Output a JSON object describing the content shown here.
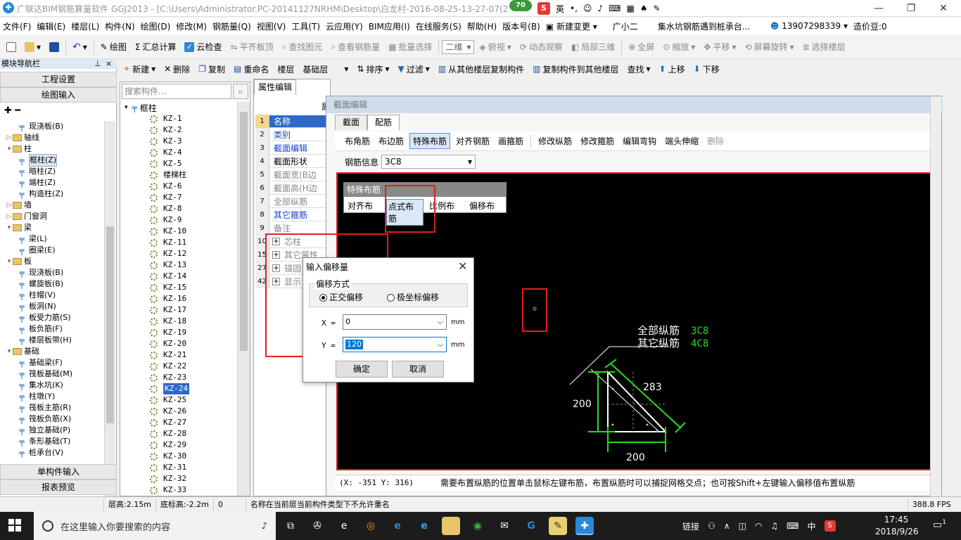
{
  "title": {
    "text": "广联达BIM钢筋算量软件 GGJ2013 - [C:\\Users\\Administrator.PC-20141127NRHM\\Desktop\\白龙村-2016-08-25-13-27-07(21",
    "badge": "70",
    "ime": [
      "英",
      "•,"
    ]
  },
  "menu": [
    "文件(F)",
    "编辑(E)",
    "楼层(L)",
    "构件(N)",
    "绘图(D)",
    "修改(M)",
    "钢筋量(Q)",
    "视图(V)",
    "工具(T)",
    "云应用(Y)",
    "BIM应用(I)",
    "在线服务(S)",
    "帮助(H)",
    "版本号(B)",
    "新建变更",
    "广小二",
    "集水坑钢筋遇到桩承台...",
    "13907298339",
    "造价豆:0"
  ],
  "toolbar1": {
    "items": [
      "绘图",
      "汇总计算",
      "云检查",
      "平齐板顶",
      "查找图元",
      "查看钢筋量",
      "批量选择"
    ],
    "view_mode": "二维",
    "right": [
      "俯视",
      "动态观察",
      "局部三维",
      "全屏",
      "缩放",
      "平移",
      "屏幕旋转",
      "选择楼层"
    ]
  },
  "toolbar2": [
    "新建",
    "删除",
    "复制",
    "重命名",
    "楼层",
    "基础层",
    "排序",
    "过滤",
    "从其他楼层复制构件",
    "复制构件到其他楼层",
    "查找",
    "上移",
    "下移"
  ],
  "nav": {
    "header": "模块导航栏",
    "buttons_top": [
      "工程设置",
      "绘图输入"
    ],
    "tree": [
      {
        "label": "现浇板(B)",
        "indent": 3,
        "type": "item"
      },
      {
        "label": "轴线",
        "indent": 1,
        "type": "folder",
        "tw": "▷"
      },
      {
        "label": "柱",
        "indent": 1,
        "type": "folder",
        "tw": "▾"
      },
      {
        "label": "框柱(Z)",
        "indent": 3,
        "type": "item",
        "sel": true
      },
      {
        "label": "暗柱(Z)",
        "indent": 3,
        "type": "item"
      },
      {
        "label": "端柱(Z)",
        "indent": 3,
        "type": "item"
      },
      {
        "label": "构造柱(Z)",
        "indent": 3,
        "type": "item"
      },
      {
        "label": "墙",
        "indent": 1,
        "type": "folder",
        "tw": "▷"
      },
      {
        "label": "门窗洞",
        "indent": 1,
        "type": "folder",
        "tw": "▷"
      },
      {
        "label": "梁",
        "indent": 1,
        "type": "folder",
        "tw": "▾"
      },
      {
        "label": "梁(L)",
        "indent": 3,
        "type": "item"
      },
      {
        "label": "圈梁(E)",
        "indent": 3,
        "type": "item"
      },
      {
        "label": "板",
        "indent": 1,
        "type": "folder",
        "tw": "▾"
      },
      {
        "label": "现浇板(B)",
        "indent": 3,
        "type": "item"
      },
      {
        "label": "螺旋板(B)",
        "indent": 3,
        "type": "item"
      },
      {
        "label": "柱帽(V)",
        "indent": 3,
        "type": "item"
      },
      {
        "label": "板洞(N)",
        "indent": 3,
        "type": "item"
      },
      {
        "label": "板受力筋(S)",
        "indent": 3,
        "type": "item"
      },
      {
        "label": "板负筋(F)",
        "indent": 3,
        "type": "item"
      },
      {
        "label": "楼层板带(H)",
        "indent": 3,
        "type": "item"
      },
      {
        "label": "基础",
        "indent": 1,
        "type": "folder",
        "tw": "▾"
      },
      {
        "label": "基础梁(F)",
        "indent": 3,
        "type": "item"
      },
      {
        "label": "筏板基础(M)",
        "indent": 3,
        "type": "item"
      },
      {
        "label": "集水坑(K)",
        "indent": 3,
        "type": "item"
      },
      {
        "label": "柱墩(Y)",
        "indent": 3,
        "type": "item"
      },
      {
        "label": "筏板主筋(R)",
        "indent": 3,
        "type": "item"
      },
      {
        "label": "筏板负筋(X)",
        "indent": 3,
        "type": "item"
      },
      {
        "label": "独立基础(P)",
        "indent": 3,
        "type": "item"
      },
      {
        "label": "条形基础(T)",
        "indent": 3,
        "type": "item"
      },
      {
        "label": "桩承台(V)",
        "indent": 3,
        "type": "item"
      }
    ],
    "buttons_bottom": [
      "单构件输入",
      "报表预览"
    ]
  },
  "list": {
    "search_placeholder": "搜索构件...",
    "root": "框柱",
    "items": [
      "KZ-1",
      "KZ-2",
      "KZ-3",
      "KZ-4",
      "KZ-5",
      "楼梯柱",
      "KZ-6",
      "KZ-7",
      "KZ-8",
      "KZ-9",
      "KZ-10",
      "KZ-11",
      "KZ-12",
      "KZ-13",
      "KZ-14",
      "KZ-15",
      "KZ-16",
      "KZ-17",
      "KZ-18",
      "KZ-19",
      "KZ-20",
      "KZ-21",
      "KZ-22",
      "KZ-23",
      "KZ-24",
      "KZ-25",
      "KZ-26",
      "KZ-27",
      "KZ-28",
      "KZ-29",
      "KZ-30",
      "KZ-31",
      "KZ-32",
      "KZ-33"
    ],
    "selected": "KZ-24"
  },
  "props": {
    "tab": "属性编辑",
    "col_header": "属",
    "rows": [
      {
        "n": "1",
        "v": "名称",
        "blue": true,
        "sel": true
      },
      {
        "n": "2",
        "v": "类别",
        "blue": true
      },
      {
        "n": "3",
        "v": "截面编辑",
        "blue": true
      },
      {
        "n": "4",
        "v": "截面形状"
      },
      {
        "n": "5",
        "v": "截面宽(B边"
      },
      {
        "n": "6",
        "v": "截面高(H边"
      },
      {
        "n": "7",
        "v": "全部纵筋"
      },
      {
        "n": "8",
        "v": "其它箍筋",
        "blue": true
      },
      {
        "n": "9",
        "v": "备注"
      },
      {
        "n": "10",
        "v": "芯柱",
        "plus": true
      },
      {
        "n": "15",
        "v": "其它属性",
        "plus": true
      },
      {
        "n": "27",
        "v": "锚固",
        "plus": true
      },
      {
        "n": "42",
        "v": "显示",
        "plus": true
      }
    ]
  },
  "section": {
    "title": "截面编辑",
    "tabs": [
      "截面",
      "配筋"
    ],
    "active_tab": "配筋",
    "toolbar": [
      "布角筋",
      "布边筋",
      "特殊布筋",
      "对齐钢筋",
      "画箍筋",
      "修改纵筋",
      "修改箍筋",
      "编辑弯钩",
      "端头伸缩",
      "删除"
    ],
    "active_tool": "特殊布筋",
    "rebar_label": "钢筋信息",
    "rebar_value": "3C8",
    "popup_title": "特殊布筋",
    "popup_items": [
      "对齐布筋",
      "点式布筋",
      "比例布筋",
      "偏移布筋"
    ],
    "popup_active": "点式布筋",
    "labels": {
      "all": "全部纵筋",
      "all_val": "3C8",
      "other": "其它纵筋",
      "other_val": "4C8",
      "dim_left": "200",
      "dim_bottom": "200",
      "dim_diag": "283"
    },
    "coords": "(X: -351 Y: 316)",
    "hint": "需要布置纵筋的位置单击鼠标左键布筋，布置纵筋时可以捕捉网格交点；也可按Shift+左键输入偏移值布置纵筋"
  },
  "dialog": {
    "title": "输入偏移量",
    "group": "偏移方式",
    "opt1": "正交偏移",
    "opt2": "极坐标偏移",
    "x_label": "X =",
    "x_value": "0",
    "y_label": "Y =",
    "y_value": "120",
    "unit": "mm",
    "ok": "确定",
    "cancel": "取消"
  },
  "status": {
    "floor_h": "层高:2.15m",
    "bottom_h": "底标高:-2.2m",
    "zero": "0",
    "msg": "名称在当前层当前构件类型下不允许重名",
    "fps": "388.8 FPS"
  },
  "taskbar": {
    "search": "在这里输入你要搜索的内容",
    "tray_text": "链接",
    "lang": "中",
    "time": "17:45",
    "date": "2018/9/26",
    "notif": "1"
  },
  "colors": {
    "accent": "#1e88e5",
    "canvas_bg": "#000000",
    "red_box": "#e02020",
    "rebar_green": "#22dd22"
  }
}
